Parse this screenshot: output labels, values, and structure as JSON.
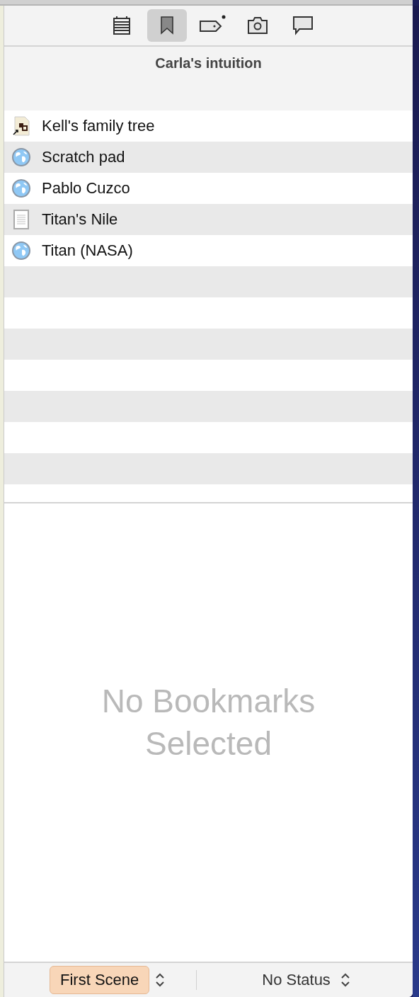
{
  "toolbar": {
    "tabs": [
      {
        "kind": "notes",
        "selected": false
      },
      {
        "kind": "bookmarks",
        "selected": true
      },
      {
        "kind": "metadata",
        "selected": false,
        "badge": true
      },
      {
        "kind": "snapshots",
        "selected": false
      },
      {
        "kind": "comments",
        "selected": false
      }
    ]
  },
  "document_title": "Carla's intuition",
  "bookmarks": [
    {
      "kind": "link",
      "label": "Kell's family tree"
    },
    {
      "kind": "web",
      "label": "Scratch pad"
    },
    {
      "kind": "web",
      "label": "Pablo Cuzco"
    },
    {
      "kind": "text",
      "label": "Titan's Nile"
    },
    {
      "kind": "web",
      "label": "Titan (NASA)"
    }
  ],
  "empty_message": "No Bookmarks Selected",
  "footer": {
    "label": {
      "text": "First Scene",
      "color": "#f8d6b8"
    },
    "status": "No Status"
  }
}
